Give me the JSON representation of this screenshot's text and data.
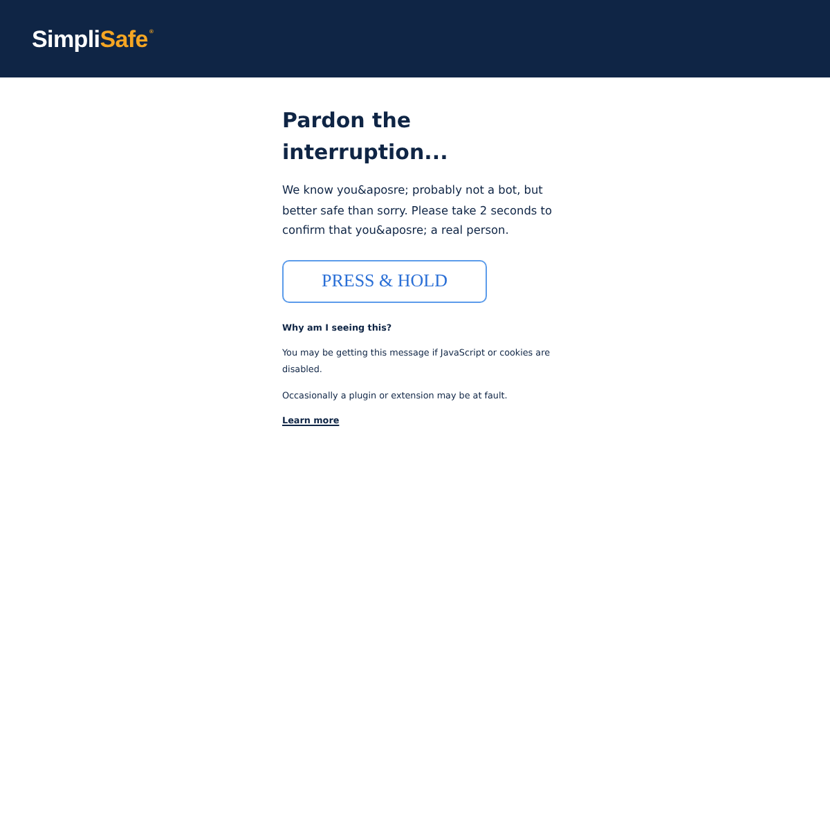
{
  "header": {
    "logo": {
      "primary": "Simpli",
      "accent": "Safe",
      "mark": "®"
    }
  },
  "main": {
    "title": "Pardon the interruption...",
    "intro": "We know you&aposre; probably not a bot, but better safe than sorry. Please take 2 seconds to confirm that you&aposre; a real person.",
    "button": {
      "label": "PRESS & HOLD"
    }
  },
  "help": {
    "heading": "Why am I seeing this?",
    "paragraphs": [
      "You may be getting this message if JavaScript or cookies are disabled.",
      "Occasionally a plugin or extension may be at fault."
    ],
    "link": "Learn more"
  }
}
